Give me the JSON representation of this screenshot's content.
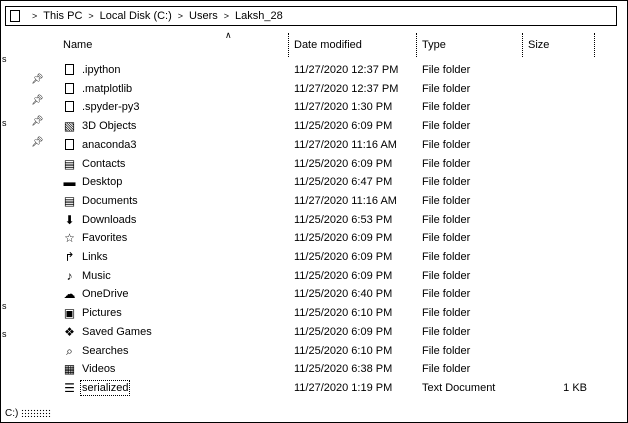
{
  "address_bar": {
    "breadcrumbs": [
      "This PC",
      "Local Disk (C:)",
      "Users",
      "Laksh_28"
    ]
  },
  "columns": {
    "name": "Name",
    "date_modified": "Date modified",
    "type": "Type",
    "size": "Size"
  },
  "files": [
    {
      "icon": "folder-icon",
      "name": ".ipython",
      "date": "11/27/2020 12:37 PM",
      "type": "File folder",
      "size": ""
    },
    {
      "icon": "folder-icon",
      "name": ".matplotlib",
      "date": "11/27/2020 12:37 PM",
      "type": "File folder",
      "size": ""
    },
    {
      "icon": "folder-icon",
      "name": ".spyder-py3",
      "date": "11/27/2020 1:30 PM",
      "type": "File folder",
      "size": ""
    },
    {
      "icon": "3d-objects-icon",
      "name": "3D Objects",
      "date": "11/25/2020 6:09 PM",
      "type": "File folder",
      "size": ""
    },
    {
      "icon": "folder-icon",
      "name": "anaconda3",
      "date": "11/27/2020 11:16 AM",
      "type": "File folder",
      "size": ""
    },
    {
      "icon": "contacts-icon",
      "name": "Contacts",
      "date": "11/25/2020 6:09 PM",
      "type": "File folder",
      "size": ""
    },
    {
      "icon": "desktop-icon",
      "name": "Desktop",
      "date": "11/25/2020 6:47 PM",
      "type": "File folder",
      "size": ""
    },
    {
      "icon": "documents-icon",
      "name": "Documents",
      "date": "11/27/2020 11:16 AM",
      "type": "File folder",
      "size": ""
    },
    {
      "icon": "downloads-icon",
      "name": "Downloads",
      "date": "11/25/2020 6:53 PM",
      "type": "File folder",
      "size": ""
    },
    {
      "icon": "favorites-icon",
      "name": "Favorites",
      "date": "11/25/2020 6:09 PM",
      "type": "File folder",
      "size": ""
    },
    {
      "icon": "links-icon",
      "name": "Links",
      "date": "11/25/2020 6:09 PM",
      "type": "File folder",
      "size": ""
    },
    {
      "icon": "music-icon",
      "name": "Music",
      "date": "11/25/2020 6:09 PM",
      "type": "File folder",
      "size": ""
    },
    {
      "icon": "onedrive-icon",
      "name": "OneDrive",
      "date": "11/25/2020 6:40 PM",
      "type": "File folder",
      "size": ""
    },
    {
      "icon": "pictures-icon",
      "name": "Pictures",
      "date": "11/25/2020 6:10 PM",
      "type": "File folder",
      "size": ""
    },
    {
      "icon": "saved-games-icon",
      "name": "Saved Games",
      "date": "11/25/2020 6:09 PM",
      "type": "File folder",
      "size": ""
    },
    {
      "icon": "searches-icon",
      "name": "Searches",
      "date": "11/25/2020 6:10 PM",
      "type": "File folder",
      "size": ""
    },
    {
      "icon": "videos-icon",
      "name": "Videos",
      "date": "11/25/2020 6:38 PM",
      "type": "File folder",
      "size": ""
    },
    {
      "icon": "text-document-icon",
      "name": "serialized",
      "date": "11/27/2020 1:19 PM",
      "type": "Text Document",
      "size": "1 KB"
    }
  ],
  "status_bar": {
    "drive": "C:)"
  }
}
